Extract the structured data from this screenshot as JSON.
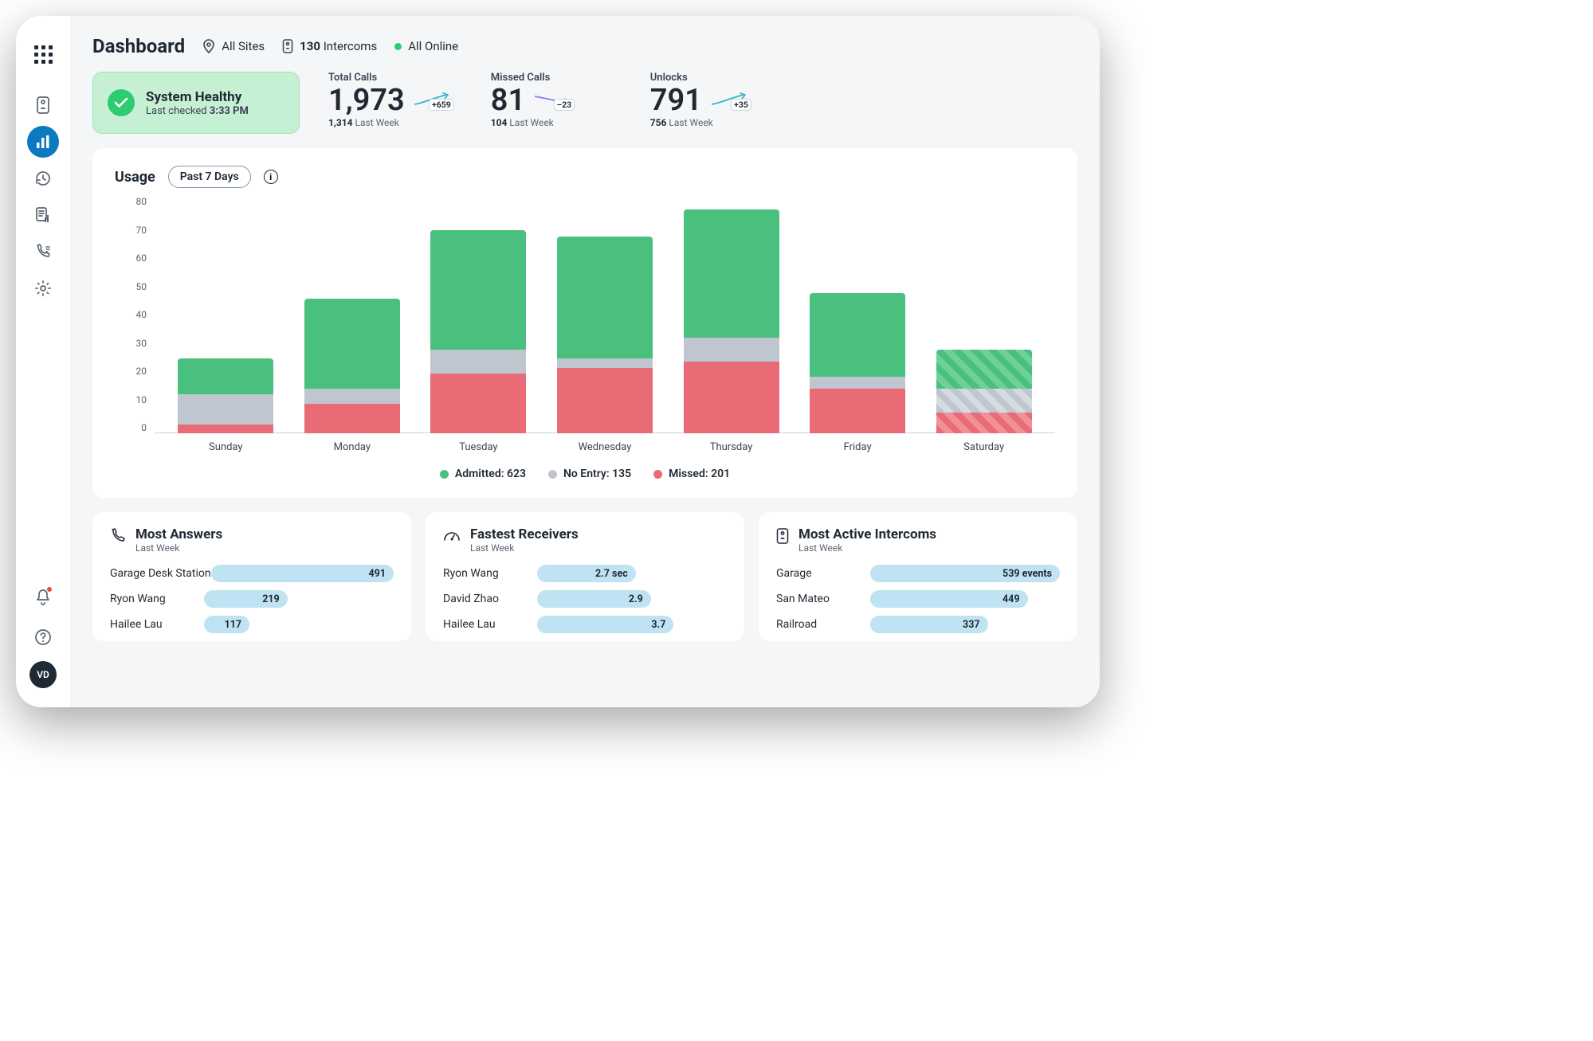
{
  "header": {
    "title": "Dashboard",
    "sites_label": "All Sites",
    "intercoms_count": "130",
    "intercoms_label": "Intercoms",
    "online_label": "All Online"
  },
  "sidebar": {
    "avatar": "VD"
  },
  "health": {
    "title": "System Healthy",
    "sub_prefix": "Last checked ",
    "time": "3:33 PM"
  },
  "kpis": [
    {
      "label": "Total Calls",
      "value": "1,973",
      "delta": "+659",
      "delta_pos": true,
      "sub_bold": "1,314",
      "sub_rest": " Last Week"
    },
    {
      "label": "Missed Calls",
      "value": "81",
      "delta": "–23",
      "delta_pos": false,
      "sub_bold": "104",
      "sub_rest": " Last Week"
    },
    {
      "label": "Unlocks",
      "value": "791",
      "delta": "+35",
      "delta_pos": true,
      "sub_bold": "756",
      "sub_rest": " Last Week"
    }
  ],
  "usage": {
    "title": "Usage",
    "range_label": "Past 7 Days"
  },
  "legend": {
    "admitted": "Admitted: 623",
    "noentry": "No Entry: 135",
    "missed": "Missed: 201"
  },
  "chart_data": {
    "type": "bar",
    "title": "Usage — Past 7 Days",
    "xlabel": "",
    "ylabel": "",
    "ylim": [
      0,
      80
    ],
    "yticks": [
      0,
      10,
      20,
      30,
      40,
      50,
      60,
      70,
      80
    ],
    "categories": [
      "Sunday",
      "Monday",
      "Tuesday",
      "Wednesday",
      "Thursday",
      "Friday",
      "Saturday"
    ],
    "series": [
      {
        "name": "Missed",
        "color": "#e86b76",
        "values": [
          3,
          10,
          20,
          22,
          24,
          15,
          7
        ]
      },
      {
        "name": "No Entry",
        "color": "#bfc6d0",
        "values": [
          10,
          5,
          8,
          3,
          8,
          4,
          8
        ]
      },
      {
        "name": "Admitted",
        "color": "#4ac07f",
        "values": [
          12,
          30,
          40,
          41,
          43,
          28,
          13
        ]
      }
    ],
    "hatched_index": 6,
    "legend_totals": {
      "Admitted": 623,
      "No Entry": 135,
      "Missed": 201
    }
  },
  "cards": {
    "answers": {
      "title": "Most Answers",
      "sub": "Last Week",
      "rows": [
        {
          "name": "Garage Desk Station",
          "value": "491",
          "pct": 100
        },
        {
          "name": "Ryon Wang",
          "value": "219",
          "pct": 44
        },
        {
          "name": "Hailee Lau",
          "value": "117",
          "pct": 24
        }
      ]
    },
    "receivers": {
      "title": "Fastest Receivers",
      "sub": "Last Week",
      "rows": [
        {
          "name": "Ryon Wang",
          "value": "2.7 sec",
          "pct": 52
        },
        {
          "name": "David Zhao",
          "value": "2.9",
          "pct": 60
        },
        {
          "name": "Hailee Lau",
          "value": "3.7",
          "pct": 72
        }
      ]
    },
    "intercoms": {
      "title": "Most Active Intercoms",
      "sub": "Last Week",
      "rows": [
        {
          "name": "Garage",
          "value": "539 events",
          "pct": 100
        },
        {
          "name": "San Mateo",
          "value": "449",
          "pct": 83
        },
        {
          "name": "Railroad",
          "value": "337",
          "pct": 62
        }
      ]
    }
  }
}
